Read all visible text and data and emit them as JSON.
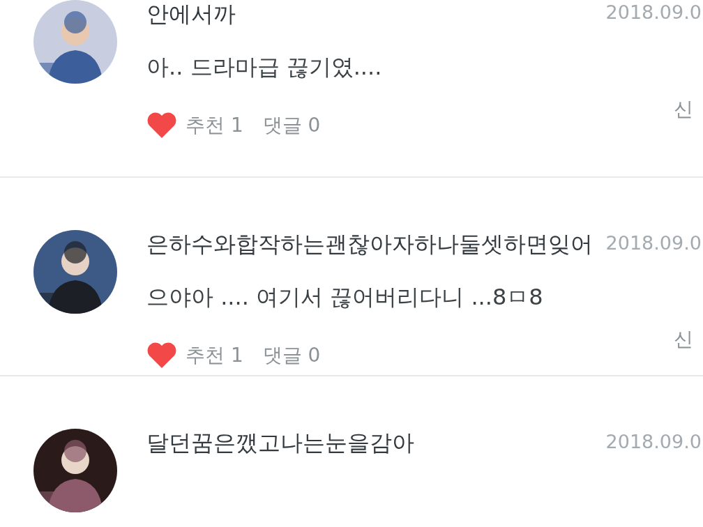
{
  "comments": [
    {
      "username": "안에서까",
      "date": "2018.09.0",
      "message": "아.. 드라마급 끊기였....",
      "likes_label": "추천 1",
      "replies_label": "댓글 0",
      "report": "신"
    },
    {
      "username": "은하수와합작하는괜찮아자하나둘셋하면잊어",
      "date": "2018.09.0",
      "message": "으야아 .... 여기서 끊어버리다니 ...8ㅁ8",
      "likes_label": "추천 1",
      "replies_label": "댓글 0",
      "report": "신"
    },
    {
      "username": "달던꿈은깼고나는눈을감아",
      "date": "2018.09.0"
    }
  ]
}
